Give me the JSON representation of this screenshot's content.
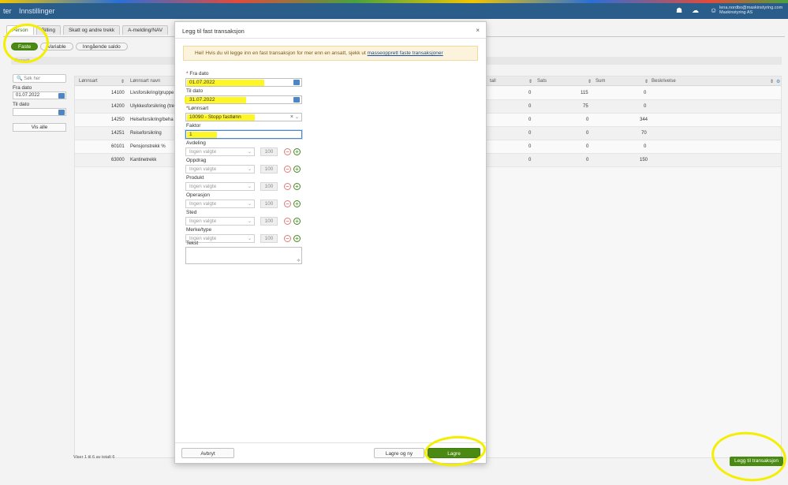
{
  "header": {
    "brand": "ter",
    "settings": "Innstillinger",
    "user_email": "lena.nordbo@maskinstyring.com",
    "user_company": "Maskinstyring AS"
  },
  "tabs": [
    "Person",
    "Billing",
    "Skatt og andre trekk",
    "A-melding/NAV"
  ],
  "pills": [
    "Faste",
    "Variable",
    "Inngående saldo"
  ],
  "subbar": "Oppsett",
  "left_panel": {
    "search_placeholder": "Søk her",
    "fra_label": "Fra dato",
    "fra_value": "01.07.2022",
    "til_label": "Til dato",
    "til_value": "",
    "vis_alle": "Vis alle"
  },
  "grid": {
    "headers": [
      "Lønnsart",
      "Lønnsart navn",
      "Sats",
      "Sum",
      "Beskrivelse"
    ],
    "rows": [
      {
        "code": "14100",
        "name": "Livsforsikring/gruppe",
        "sats": "0",
        "sum": "115",
        "extra": "0"
      },
      {
        "code": "14200",
        "name": "Ulykkesforsikring (tre",
        "sats": "0",
        "sum": "75",
        "extra": "0"
      },
      {
        "code": "14250",
        "name": "Helseforsikring/beha",
        "sats": "0",
        "sum": "0",
        "extra": "344"
      },
      {
        "code": "14251",
        "name": "Reiseforsikring",
        "sats": "0",
        "sum": "0",
        "extra": "70"
      },
      {
        "code": "60101",
        "name": "Pensjonstrekk %",
        "sats": "0",
        "sum": "0",
        "extra": "0"
      },
      {
        "code": "63000",
        "name": "Kantinetrekk",
        "sats": "0",
        "sum": "0",
        "extra": "150"
      }
    ],
    "footer": "Viser 1 til 6 av totalt 6",
    "hidden_col": "tall"
  },
  "add_button": "Legg til transaksjon",
  "modal": {
    "title": "Legg til fast transaksjon",
    "close": "×",
    "info_text": "Hei! Hvis du vil legge inn en fast transaksjon for mer enn en ansatt, sjekk ut",
    "info_link": "masseopprett faste transaksjoner",
    "fra_label": "Fra dato",
    "fra_value": "01.07.2022",
    "til_label": "Til dato",
    "til_value": "31.07.2022",
    "lonnsart_label": "Lønnsart",
    "lonnsart_value": "10090 - Stopp fastlønn",
    "faktor_label": "Faktor",
    "faktor_value": "1",
    "dimensions": [
      {
        "label": "Avdeling",
        "placeholder": "Ingen valgte",
        "pct": "100"
      },
      {
        "label": "Oppdrag",
        "placeholder": "Ingen valgte",
        "pct": "100"
      },
      {
        "label": "Produkt",
        "placeholder": "Ingen valgte",
        "pct": "100"
      },
      {
        "label": "Operasjon",
        "placeholder": "Ingen valgte",
        "pct": "100"
      },
      {
        "label": "Sted",
        "placeholder": "Ingen valgte",
        "pct": "100"
      },
      {
        "label": "Merke/type",
        "placeholder": "Ingen valgte",
        "pct": "100"
      }
    ],
    "tekst_label": "Tekst",
    "btn_cancel": "Avbryt",
    "btn_save_new": "Lagre og ny",
    "btn_save": "Lagre"
  }
}
